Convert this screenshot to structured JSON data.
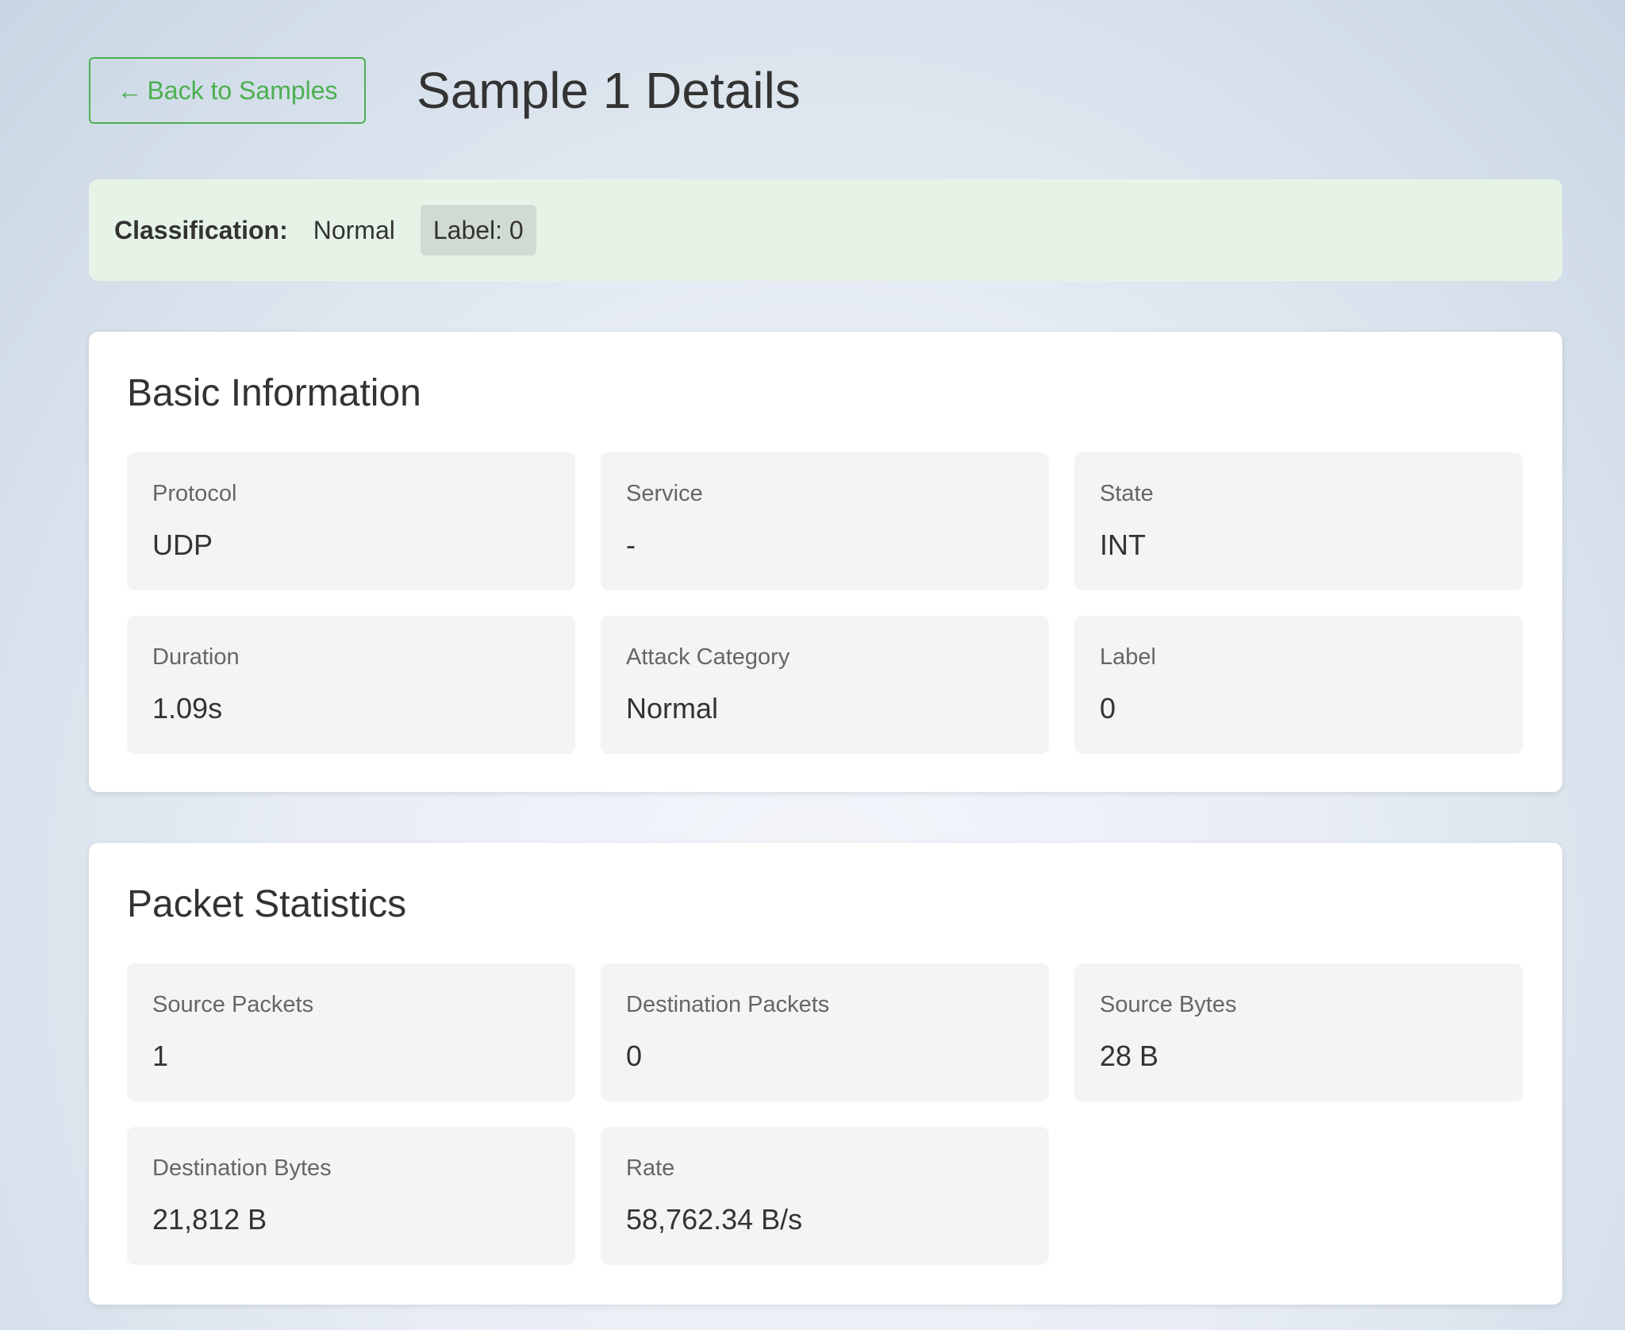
{
  "header": {
    "back_arrow": "←",
    "back_label": "Back to Samples",
    "title": "Sample 1 Details"
  },
  "classification": {
    "label": "Classification:",
    "value": "Normal",
    "badge": "Label: 0"
  },
  "basic_info": {
    "title": "Basic Information",
    "fields": [
      {
        "label": "Protocol",
        "value": "UDP"
      },
      {
        "label": "Service",
        "value": "-"
      },
      {
        "label": "State",
        "value": "INT"
      },
      {
        "label": "Duration",
        "value": "1.09s"
      },
      {
        "label": "Attack Category",
        "value": "Normal"
      },
      {
        "label": "Label",
        "value": "0"
      }
    ]
  },
  "packet_stats": {
    "title": "Packet Statistics",
    "fields": [
      {
        "label": "Source Packets",
        "value": "1"
      },
      {
        "label": "Destination Packets",
        "value": "0"
      },
      {
        "label": "Source Bytes",
        "value": "28 B"
      },
      {
        "label": "Destination Bytes",
        "value": "21,812 B"
      },
      {
        "label": "Rate",
        "value": "58,762.34 B/s"
      }
    ]
  },
  "colors": {
    "accent": "#4caf50",
    "classification_bg": "#e6f4e7",
    "field_bg": "#f4f4f4"
  }
}
